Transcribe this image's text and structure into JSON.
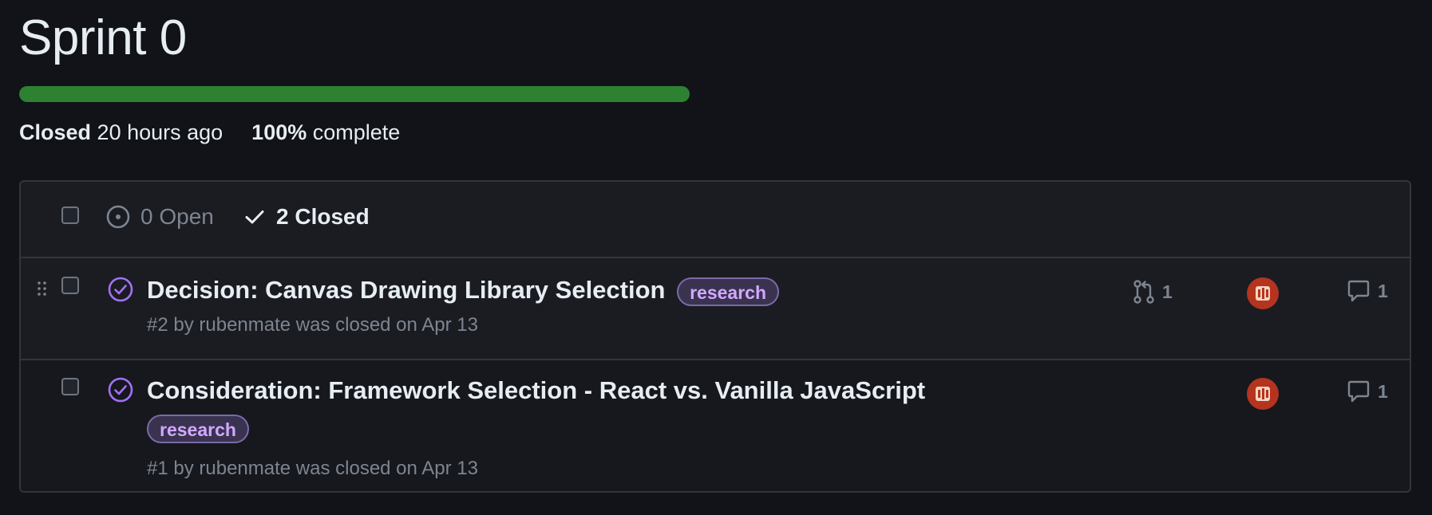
{
  "milestone": {
    "title": "Sprint 0",
    "progress_percent": 100,
    "status_bold": "Closed",
    "status_time": "20 hours ago",
    "percent_label": "100%",
    "complete_label": "complete"
  },
  "colors": {
    "progress": "#2f8132",
    "closed_icon": "#a371f7",
    "label_text": "#d2a8ff"
  },
  "filters": {
    "open_label": "0 Open",
    "closed_label": "2 Closed",
    "open_icon": "issue-opened-icon",
    "closed_icon": "check-icon"
  },
  "issues": [
    {
      "title": "Decision: Canvas Drawing Library Selection",
      "label": "research",
      "meta": "#2 by rubenmate was closed on Apr 13",
      "linked_prs": "1",
      "comments": "1",
      "icon": "issue-closed-icon"
    },
    {
      "title": "Consideration: Framework Selection - React vs. Vanilla JavaScript",
      "label": "research",
      "meta": "#1 by rubenmate was closed on Apr 13",
      "comments": "1",
      "icon": "issue-closed-icon"
    }
  ]
}
